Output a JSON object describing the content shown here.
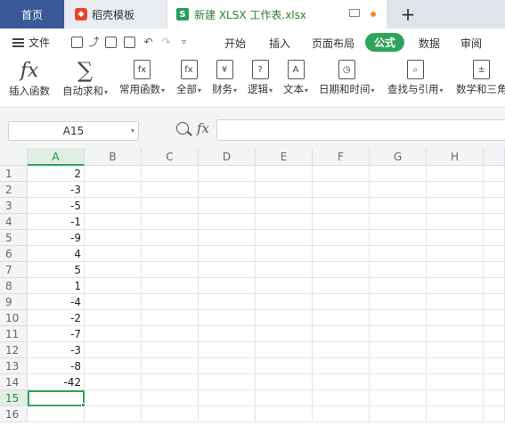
{
  "tabs": {
    "home": "首页",
    "daoke": "稻壳模板",
    "file": "新建 XLSX 工作表.xlsx",
    "new_tab": "+"
  },
  "menu": {
    "file": "文件",
    "items": [
      "开始",
      "插入",
      "页面布局",
      "公式",
      "数据",
      "审阅"
    ],
    "active": "公式"
  },
  "ribbon": {
    "insert_function": "插入函数",
    "autosum": "自动求和",
    "common_functions": "常用函数",
    "all": "全部",
    "finance": "财务",
    "logic": "逻辑",
    "text": "文本",
    "datetime": "日期和时间",
    "lookup": "查找与引用",
    "math_trig": "数学和三角"
  },
  "formula_bar": {
    "name_box": "A15",
    "fx": "fx",
    "value": ""
  },
  "sheet": {
    "columns": [
      "A",
      "B",
      "C",
      "D",
      "E",
      "F",
      "G",
      "H"
    ],
    "rows": [
      "1",
      "2",
      "3",
      "4",
      "5",
      "6",
      "7",
      "8",
      "9",
      "10",
      "11",
      "12",
      "13",
      "14",
      "15",
      "16"
    ],
    "column_a_values": [
      "2",
      "-3",
      "-5",
      "-1",
      "-9",
      "4",
      "5",
      "1",
      "-4",
      "-2",
      "-7",
      "-3",
      "-8",
      "-42",
      "",
      ""
    ],
    "selected_cell": "A15"
  },
  "colors": {
    "accent": "#2fa35b",
    "home_tab": "#3b5998",
    "tabbar": "#dfe3ea"
  }
}
